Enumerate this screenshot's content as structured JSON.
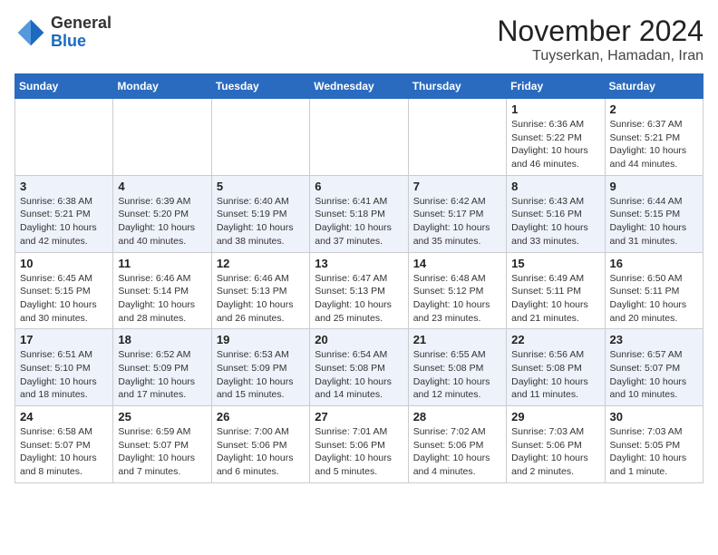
{
  "header": {
    "logo_general": "General",
    "logo_blue": "Blue",
    "month": "November 2024",
    "location": "Tuyserkan, Hamadan, Iran"
  },
  "weekdays": [
    "Sunday",
    "Monday",
    "Tuesday",
    "Wednesday",
    "Thursday",
    "Friday",
    "Saturday"
  ],
  "weeks": [
    [
      {
        "day": "",
        "info": ""
      },
      {
        "day": "",
        "info": ""
      },
      {
        "day": "",
        "info": ""
      },
      {
        "day": "",
        "info": ""
      },
      {
        "day": "",
        "info": ""
      },
      {
        "day": "1",
        "info": "Sunrise: 6:36 AM\nSunset: 5:22 PM\nDaylight: 10 hours\nand 46 minutes."
      },
      {
        "day": "2",
        "info": "Sunrise: 6:37 AM\nSunset: 5:21 PM\nDaylight: 10 hours\nand 44 minutes."
      }
    ],
    [
      {
        "day": "3",
        "info": "Sunrise: 6:38 AM\nSunset: 5:21 PM\nDaylight: 10 hours\nand 42 minutes."
      },
      {
        "day": "4",
        "info": "Sunrise: 6:39 AM\nSunset: 5:20 PM\nDaylight: 10 hours\nand 40 minutes."
      },
      {
        "day": "5",
        "info": "Sunrise: 6:40 AM\nSunset: 5:19 PM\nDaylight: 10 hours\nand 38 minutes."
      },
      {
        "day": "6",
        "info": "Sunrise: 6:41 AM\nSunset: 5:18 PM\nDaylight: 10 hours\nand 37 minutes."
      },
      {
        "day": "7",
        "info": "Sunrise: 6:42 AM\nSunset: 5:17 PM\nDaylight: 10 hours\nand 35 minutes."
      },
      {
        "day": "8",
        "info": "Sunrise: 6:43 AM\nSunset: 5:16 PM\nDaylight: 10 hours\nand 33 minutes."
      },
      {
        "day": "9",
        "info": "Sunrise: 6:44 AM\nSunset: 5:15 PM\nDaylight: 10 hours\nand 31 minutes."
      }
    ],
    [
      {
        "day": "10",
        "info": "Sunrise: 6:45 AM\nSunset: 5:15 PM\nDaylight: 10 hours\nand 30 minutes."
      },
      {
        "day": "11",
        "info": "Sunrise: 6:46 AM\nSunset: 5:14 PM\nDaylight: 10 hours\nand 28 minutes."
      },
      {
        "day": "12",
        "info": "Sunrise: 6:46 AM\nSunset: 5:13 PM\nDaylight: 10 hours\nand 26 minutes."
      },
      {
        "day": "13",
        "info": "Sunrise: 6:47 AM\nSunset: 5:13 PM\nDaylight: 10 hours\nand 25 minutes."
      },
      {
        "day": "14",
        "info": "Sunrise: 6:48 AM\nSunset: 5:12 PM\nDaylight: 10 hours\nand 23 minutes."
      },
      {
        "day": "15",
        "info": "Sunrise: 6:49 AM\nSunset: 5:11 PM\nDaylight: 10 hours\nand 21 minutes."
      },
      {
        "day": "16",
        "info": "Sunrise: 6:50 AM\nSunset: 5:11 PM\nDaylight: 10 hours\nand 20 minutes."
      }
    ],
    [
      {
        "day": "17",
        "info": "Sunrise: 6:51 AM\nSunset: 5:10 PM\nDaylight: 10 hours\nand 18 minutes."
      },
      {
        "day": "18",
        "info": "Sunrise: 6:52 AM\nSunset: 5:09 PM\nDaylight: 10 hours\nand 17 minutes."
      },
      {
        "day": "19",
        "info": "Sunrise: 6:53 AM\nSunset: 5:09 PM\nDaylight: 10 hours\nand 15 minutes."
      },
      {
        "day": "20",
        "info": "Sunrise: 6:54 AM\nSunset: 5:08 PM\nDaylight: 10 hours\nand 14 minutes."
      },
      {
        "day": "21",
        "info": "Sunrise: 6:55 AM\nSunset: 5:08 PM\nDaylight: 10 hours\nand 12 minutes."
      },
      {
        "day": "22",
        "info": "Sunrise: 6:56 AM\nSunset: 5:08 PM\nDaylight: 10 hours\nand 11 minutes."
      },
      {
        "day": "23",
        "info": "Sunrise: 6:57 AM\nSunset: 5:07 PM\nDaylight: 10 hours\nand 10 minutes."
      }
    ],
    [
      {
        "day": "24",
        "info": "Sunrise: 6:58 AM\nSunset: 5:07 PM\nDaylight: 10 hours\nand 8 minutes."
      },
      {
        "day": "25",
        "info": "Sunrise: 6:59 AM\nSunset: 5:07 PM\nDaylight: 10 hours\nand 7 minutes."
      },
      {
        "day": "26",
        "info": "Sunrise: 7:00 AM\nSunset: 5:06 PM\nDaylight: 10 hours\nand 6 minutes."
      },
      {
        "day": "27",
        "info": "Sunrise: 7:01 AM\nSunset: 5:06 PM\nDaylight: 10 hours\nand 5 minutes."
      },
      {
        "day": "28",
        "info": "Sunrise: 7:02 AM\nSunset: 5:06 PM\nDaylight: 10 hours\nand 4 minutes."
      },
      {
        "day": "29",
        "info": "Sunrise: 7:03 AM\nSunset: 5:06 PM\nDaylight: 10 hours\nand 2 minutes."
      },
      {
        "day": "30",
        "info": "Sunrise: 7:03 AM\nSunset: 5:05 PM\nDaylight: 10 hours\nand 1 minute."
      }
    ]
  ]
}
